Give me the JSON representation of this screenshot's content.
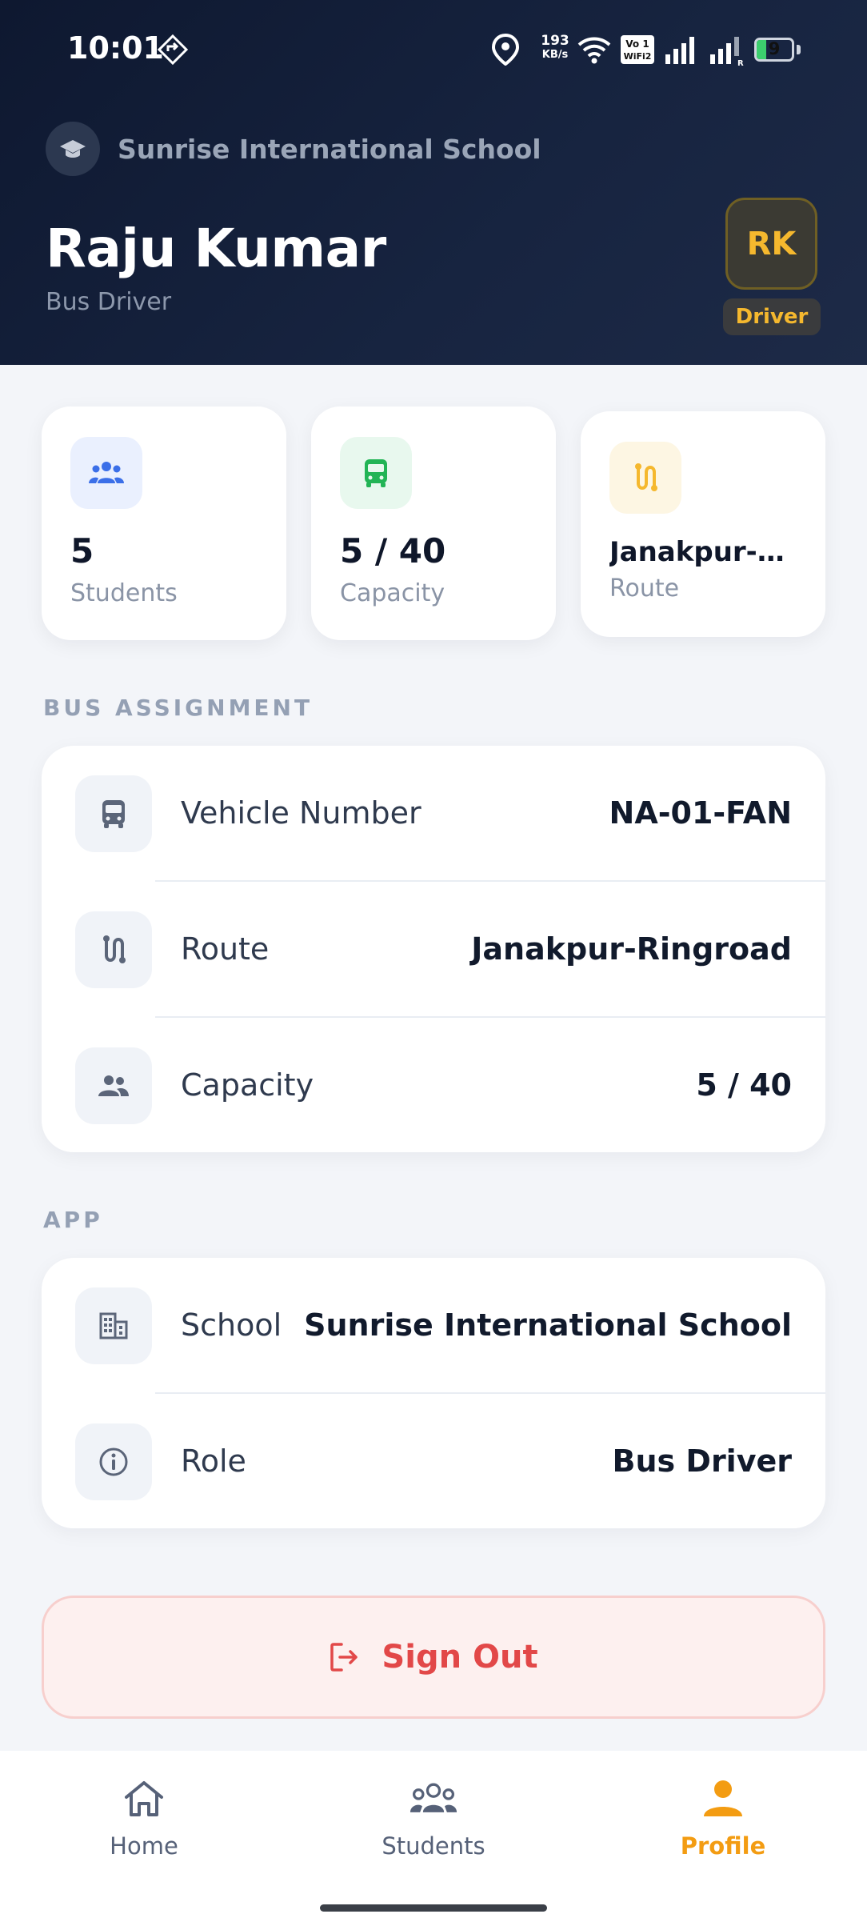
{
  "status_bar": {
    "time": "10:01",
    "network_speed": "193",
    "network_unit": "KB/s",
    "battery_level": 9,
    "battery_fraction": 0.27,
    "icons": [
      "navigation-diamond-icon",
      "location-icon",
      "wifi-icon",
      "volte-wifi2-icon",
      "signal-icon",
      "signal-roaming-icon",
      "battery-charging-icon"
    ]
  },
  "header": {
    "school_name": "Sunrise International School",
    "user_name": "Raju Kumar",
    "user_role": "Bus Driver",
    "avatar_initials": "RK",
    "role_badge": "Driver"
  },
  "stats": [
    {
      "value": "5",
      "label": "Students",
      "icon": "students-icon",
      "accent": "#3b6fe8",
      "bg": "#eaf0fe"
    },
    {
      "value": "5 / 40",
      "label": "Capacity",
      "icon": "bus-icon",
      "accent": "#22b455",
      "bg": "#e8f8ee"
    },
    {
      "value": "Janakpur-…",
      "label": "Route",
      "icon": "route-icon",
      "accent": "#f5b82e",
      "bg": "#fdf6e3"
    }
  ],
  "bus_assignment": {
    "section_title": "BUS ASSIGNMENT",
    "rows": [
      {
        "label": "Vehicle Number",
        "value": "NA-01-FAN",
        "icon": "bus-icon"
      },
      {
        "label": "Route",
        "value": "Janakpur-Ringroad",
        "icon": "route-icon"
      },
      {
        "label": "Capacity",
        "value": "5 / 40",
        "icon": "people-icon"
      }
    ]
  },
  "app_section": {
    "section_title": "APP",
    "rows": [
      {
        "label": "School",
        "value": "Sunrise International School",
        "icon": "building-icon"
      },
      {
        "label": "Role",
        "value": "Bus Driver",
        "icon": "info-icon"
      }
    ]
  },
  "sign_out": {
    "label": "Sign Out",
    "color": "#e24848"
  },
  "bottom_nav": [
    {
      "label": "Home",
      "icon": "home-icon",
      "active": false
    },
    {
      "label": "Students",
      "icon": "students-icon",
      "active": false
    },
    {
      "label": "Profile",
      "icon": "profile-icon",
      "active": true
    }
  ],
  "colors": {
    "header_bg": "#111c33",
    "accent_gold": "#f5b82e",
    "active_nav": "#f39c12"
  }
}
